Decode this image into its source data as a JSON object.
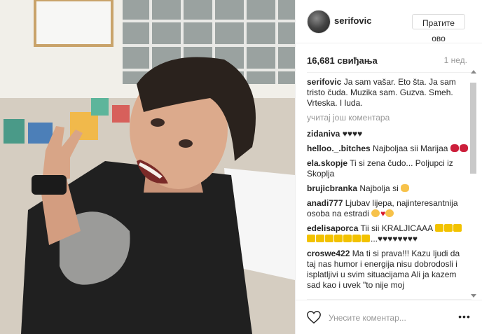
{
  "post": {
    "username": "serifovic",
    "follow_label": "Пратите ово",
    "likes": "16,681 свиђања",
    "time_ago": "1 нед.",
    "caption": {
      "username": "serifovic",
      "text": "Ja sam vašar. Eto šta. Ja sam tristo čuda. Muzika sam. Guzva. Smeh. Vrteska. I luda."
    },
    "load_more": "учитај још коментара",
    "comments": [
      {
        "user": "zidaniva",
        "text": "♥♥♥♥",
        "emojis": []
      },
      {
        "user": "helloo._.bitches",
        "text": "Najboljaa sii Marijaa",
        "emojis": [
          "kiss-emoji",
          "kiss-emoji"
        ]
      },
      {
        "user": "ela.skopje",
        "text": "Ti si zena čudo... Poljupci iz Skoplja",
        "emojis": []
      },
      {
        "user": "brujicbranka",
        "text": "Najbolja si",
        "emojis": [
          "thumbs-up-emoji"
        ]
      },
      {
        "user": "anadi777",
        "text": "Ljubav lijepa, najinteresantnija osoba na estradi",
        "emojis": [
          "heart-eyes-emoji",
          "heart-emoji",
          "kiss-face-emoji"
        ]
      },
      {
        "user": "edelisaporca",
        "text": "Tii sii KRALJICAAA",
        "emojis": [
          "crown-emoji",
          "crown-emoji",
          "crown-emoji",
          "crown-emoji",
          "crown-emoji",
          "crown-emoji",
          "crown-emoji",
          "crown-emoji",
          "crown-emoji",
          "crown-emoji"
        ],
        "tail": "...♥♥♥♥♥♥♥♥"
      },
      {
        "user": "croswe422",
        "text": "Ma ti si prava!!! Kazu ljudi da taj nas humor i energija nisu dobrodosli i isplatljivi u svim situacijama Ali ja kazem sad kao i uvek \"to nije moj",
        "emojis": []
      }
    ],
    "comment_placeholder": "Унесите коментар..."
  },
  "colors": {
    "text": "#262626",
    "muted": "#999999",
    "border": "#efefef",
    "heart": "#d7192c",
    "crown": "#f2c200"
  }
}
